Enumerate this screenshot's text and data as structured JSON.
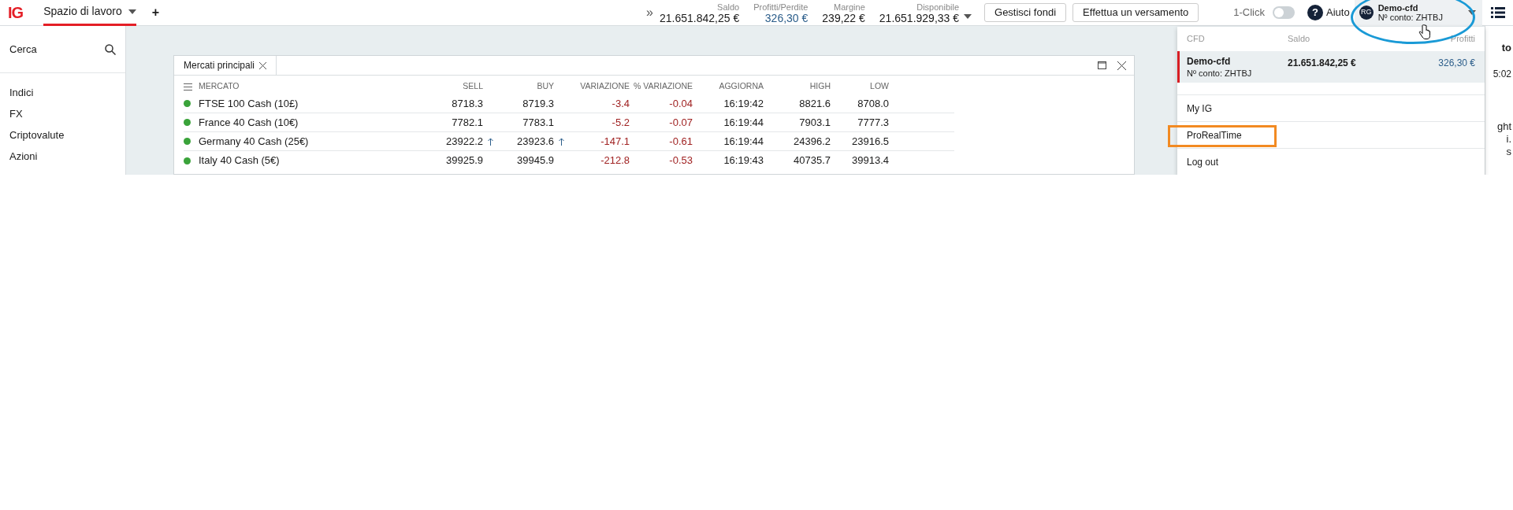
{
  "top_bar": {
    "logo": "IG",
    "tabs": [
      {
        "label": "Spazio di lavoro",
        "selected": true
      }
    ],
    "add": "+",
    "expand": "»",
    "stats": [
      {
        "label": "Saldo",
        "value": "21.651.842,25 €",
        "kind": "plain"
      },
      {
        "label": "Profitti/Perdite",
        "value": "326,30 €",
        "kind": "profit"
      },
      {
        "label": "Margine",
        "value": "239,22 €",
        "kind": "plain"
      },
      {
        "label": "Disponibile",
        "value": "21.651.929,33 €",
        "kind": "plain"
      }
    ],
    "buttons": [
      "Gestisci fondi",
      "Effettua un versamento"
    ],
    "one_click": {
      "label": "1-Click",
      "on": false
    },
    "help": {
      "icon": "?",
      "label": "Aiuto"
    },
    "account": {
      "avatar": "RG",
      "name": "Demo-cfd",
      "number": "Nº conto: ZHTBJ"
    }
  },
  "sidebar": {
    "search": "Cerca",
    "items": [
      "Indici",
      "FX",
      "Criptovalute",
      "Azioni"
    ]
  },
  "panel": {
    "tab": "Mercati principali",
    "columns": [
      "MERCATO",
      "SELL",
      "BUY",
      "VARIAZIONE",
      "% VARIAZIONE",
      "AGGIORNA",
      "HIGH",
      "LOW"
    ],
    "rows": [
      {
        "market": "FTSE 100 Cash (10£)",
        "sell": "8718.3",
        "sell_up": false,
        "buy": "8719.3",
        "buy_up": false,
        "change": "-3.4",
        "pct": "-0.04",
        "time": "16:19:42",
        "high": "8821.6",
        "low": "8708.0"
      },
      {
        "market": "France 40 Cash (10€)",
        "sell": "7782.1",
        "sell_up": false,
        "buy": "7783.1",
        "buy_up": false,
        "change": "-5.2",
        "pct": "-0.07",
        "time": "16:19:44",
        "high": "7903.1",
        "low": "7777.3"
      },
      {
        "market": "Germany 40 Cash (25€)",
        "sell": "23922.2",
        "sell_up": true,
        "buy": "23923.6",
        "buy_up": true,
        "change": "-147.1",
        "pct": "-0.61",
        "time": "16:19:44",
        "high": "24396.2",
        "low": "23916.5"
      },
      {
        "market": "Italy 40 Cash (5€)",
        "sell": "39925.9",
        "sell_up": false,
        "buy": "39945.9",
        "buy_up": false,
        "change": "-212.8",
        "pct": "-0.53",
        "time": "16:19:43",
        "high": "40735.7",
        "low": "39913.4"
      }
    ]
  },
  "right_panel": {
    "header": "to",
    "lines": [
      "5:02",
      "ght",
      "i.",
      "s"
    ]
  },
  "account_menu": {
    "columns": [
      "CFD",
      "Saldo",
      "Profitti"
    ],
    "accounts": [
      {
        "name": "Demo-cfd",
        "number": "Nº conto: ZHTBJ",
        "balance": "21.651.842,25 €",
        "profit": "326,30 €",
        "selected": true
      }
    ],
    "items": [
      {
        "label": "My IG",
        "highlighted": false
      },
      {
        "label": "ProRealTime",
        "highlighted": true
      },
      {
        "label": "Log out",
        "highlighted": false
      }
    ]
  }
}
